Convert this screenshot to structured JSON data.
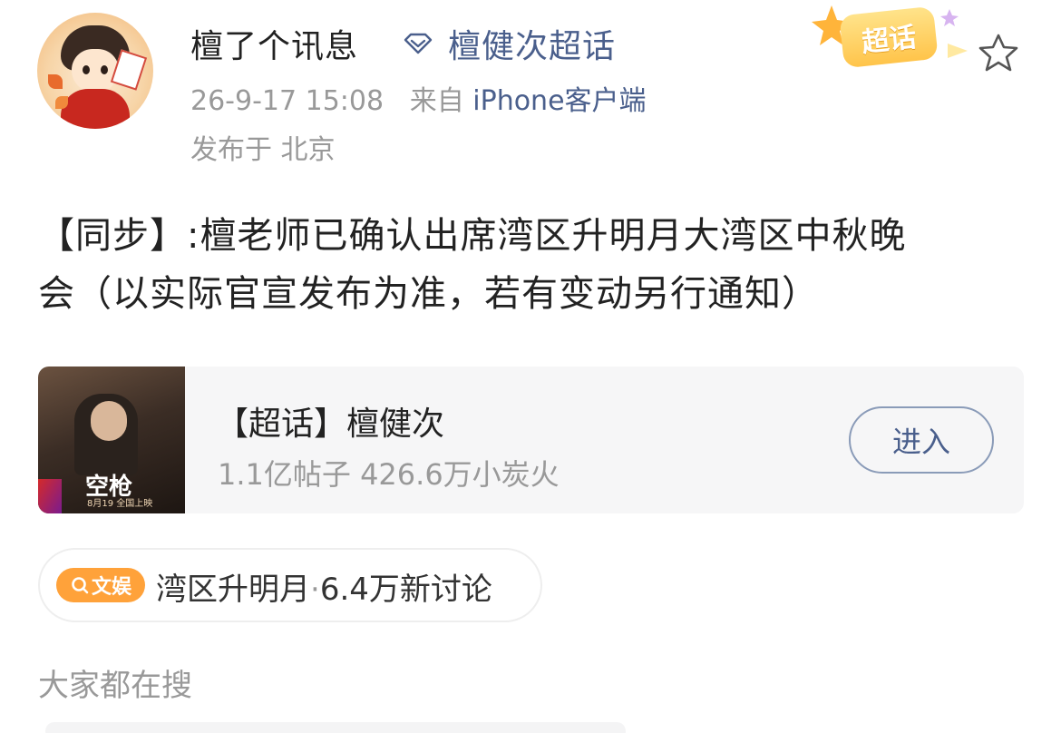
{
  "post": {
    "username": "檀了个讯息",
    "supertopic_link": "檀健次超话",
    "timestamp": "26-9-17 15:08",
    "source_prefix": "来自",
    "source_client": "iPhone客户端",
    "location": "发布于 北京",
    "badge_label": "超话",
    "content_line1": "【同步】:檀老师已确认出席湾区升明月大湾区中秋晚",
    "content_line2": "会（以实际官宣发布为准，若有变动另行通知）"
  },
  "topic_card": {
    "title": "【超话】檀健次",
    "stats": "1.1亿帖子 426.6万小炭火",
    "enter_label": "进入",
    "cover_title": "空枪",
    "cover_date": "8月19 全国上映"
  },
  "hot_search": {
    "tag_label": "文娱",
    "topic": "湾区升明月",
    "separator": "·",
    "discussion": "6.4万新讨论"
  },
  "section": {
    "title": "大家都在搜"
  },
  "colors": {
    "link_blue": "#4a5f8c",
    "meta_gray": "#999999",
    "hot_orange": "#ffa23a",
    "badge_yellow": "#ffc44a"
  },
  "icons": {
    "diamond": "diamond-icon",
    "star": "star-outline-icon",
    "search": "search-icon"
  }
}
